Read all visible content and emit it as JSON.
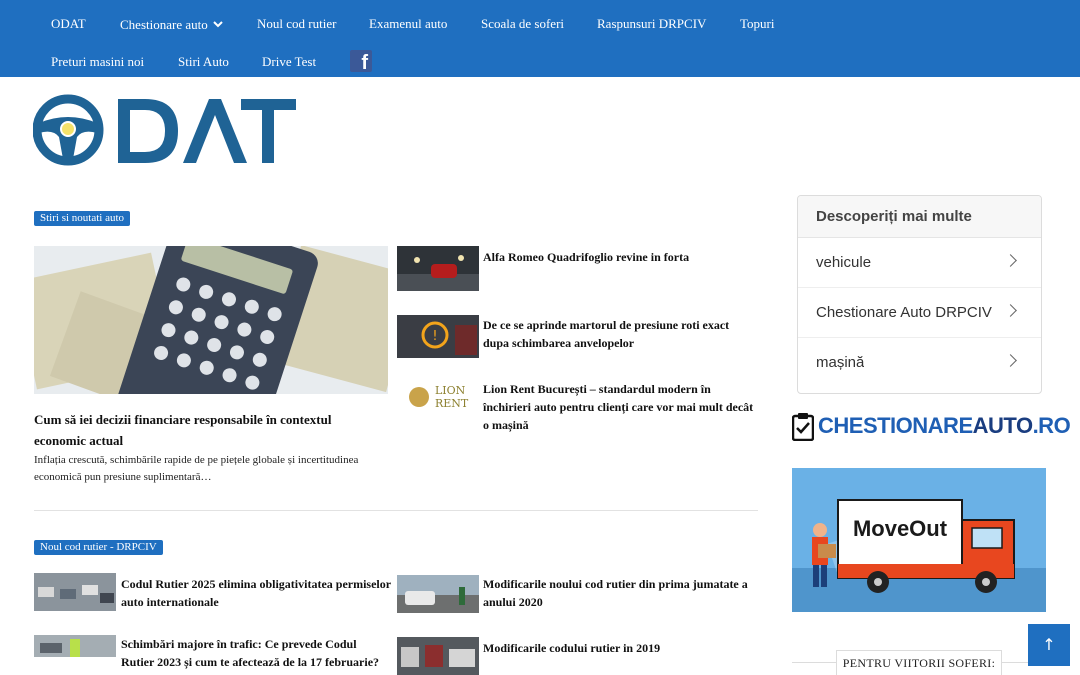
{
  "nav": {
    "items": [
      {
        "label": "ODAT"
      },
      {
        "label": "Chestionare auto"
      },
      {
        "label": "Noul cod rutier"
      },
      {
        "label": "Examenul auto"
      },
      {
        "label": "Scoala de soferi"
      },
      {
        "label": "Raspunsuri DRPCIV"
      },
      {
        "label": "Topuri"
      },
      {
        "label": "Preturi masini noi"
      },
      {
        "label": "Stiri Auto"
      },
      {
        "label": "Drive Test"
      }
    ],
    "facebook_icon": "facebook-icon"
  },
  "logo": {
    "text": "ODAT",
    "color": "#1f6395"
  },
  "section1": {
    "badge": "Stiri si noutati auto",
    "featured": {
      "title": "Cum să iei decizii financiare responsabile în contextul economic actual",
      "excerpt": "Inflația crescută, schimbările rapide de pe piețele globale și incertitudinea economică pun presiune suplimentară…"
    },
    "side": [
      {
        "title": "Alfa Romeo Quadrifoglio revine in forta"
      },
      {
        "title": "De ce se aprinde martorul de presiune roti exact dupa schimbarea anvelopelor"
      },
      {
        "title": "Lion Rent București – standardul modern în închirieri auto pentru clienți care vor mai mult decât o mașină",
        "logo_top": "LION",
        "logo_bottom": "RENT"
      }
    ]
  },
  "section2": {
    "badge": "Noul cod rutier - DRPCIV",
    "items": [
      {
        "title": "Codul Rutier 2025 elimina obligativitatea permiselor auto internationale"
      },
      {
        "title": "Modificarile noului cod rutier din prima jumatate a anului 2020"
      },
      {
        "title": "Schimbări majore în trafic: Ce prevede Codul Rutier 2023 și cum te afectează de la 17 februarie?"
      },
      {
        "title": "Modificarile codului rutier in 2019"
      }
    ]
  },
  "sidebar": {
    "discover": {
      "title": "Descoperiți mai multe",
      "items": [
        {
          "label": "vehicule"
        },
        {
          "label": "Chestionare Auto DRPCIV"
        },
        {
          "label": "mașină"
        }
      ]
    },
    "chestionare_logo": {
      "part1": "CHESTIONARE",
      "part2": "AUTO",
      "part3": ".RO"
    },
    "ad": {
      "text": "MoveOut"
    },
    "future_drivers": "PENTRU VIITORII SOFERI:"
  },
  "scroll_top": "↑",
  "colors": {
    "accent": "#1f6fc0",
    "logo": "#1f6395",
    "logo_dot": "#f5e26a"
  }
}
